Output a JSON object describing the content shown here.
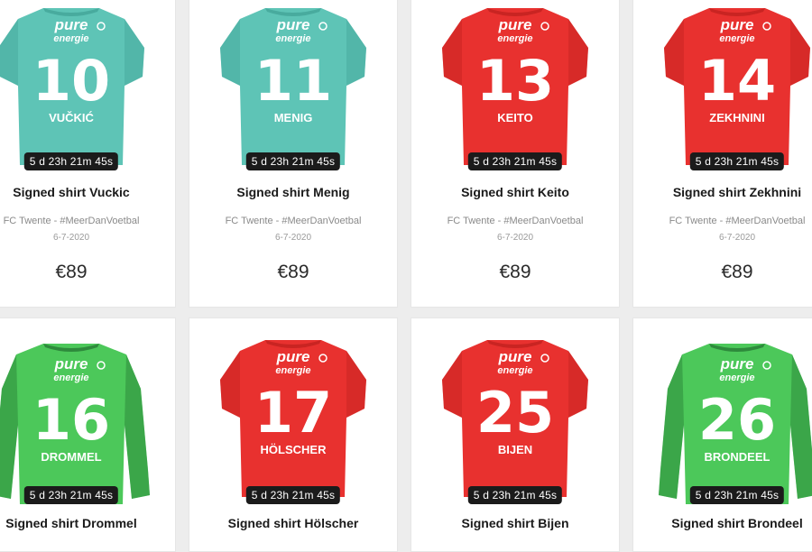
{
  "products": [
    {
      "title": "Signed shirt Vuckic",
      "subtitle": "FC Twente - #MeerDanVoetbal",
      "date": "6-7-2020",
      "price": "€89",
      "timer": "5 d 23h 21m 45s",
      "number": "10",
      "name": "VUČKIĆ",
      "sponsor_top": "pure",
      "sponsor_bottom": "energie",
      "shirt_color": "#5ec4b6",
      "shirt_shade": "#48ab9e",
      "sleeve": "short"
    },
    {
      "title": "Signed shirt Menig",
      "subtitle": "FC Twente - #MeerDanVoetbal",
      "date": "6-7-2020",
      "price": "€89",
      "timer": "5 d 23h 21m 45s",
      "number": "11",
      "name": "MENIG",
      "sponsor_top": "pure",
      "sponsor_bottom": "energie",
      "shirt_color": "#5ec4b6",
      "shirt_shade": "#48ab9e",
      "sleeve": "short"
    },
    {
      "title": "Signed shirt Keito",
      "subtitle": "FC Twente - #MeerDanVoetbal",
      "date": "6-7-2020",
      "price": "€89",
      "timer": "5 d 23h 21m 45s",
      "number": "13",
      "name": "KEITO",
      "sponsor_top": "pure",
      "sponsor_bottom": "energie",
      "shirt_color": "#e8312f",
      "shirt_shade": "#c92422",
      "sleeve": "short"
    },
    {
      "title": "Signed shirt Zekhnini",
      "subtitle": "FC Twente - #MeerDanVoetbal",
      "date": "6-7-2020",
      "price": "€89",
      "timer": "5 d 23h 21m 45s",
      "number": "14",
      "name": "ZEKHNINI",
      "sponsor_top": "pure",
      "sponsor_bottom": "energie",
      "shirt_color": "#e8312f",
      "shirt_shade": "#c92422",
      "sleeve": "short"
    },
    {
      "title": "Signed shirt Drommel",
      "timer": "5 d 23h 21m 45s",
      "number": "16",
      "name": "DROMMEL",
      "sponsor_top": "pure",
      "sponsor_bottom": "energie",
      "shirt_color": "#4cc85a",
      "shirt_shade": "#2e8a3c",
      "sleeve": "long"
    },
    {
      "title": "Signed shirt Hölscher",
      "timer": "5 d 23h 21m 45s",
      "number": "17",
      "name": "HÖLSCHER",
      "sponsor_top": "pure",
      "sponsor_bottom": "energie",
      "shirt_color": "#e8312f",
      "shirt_shade": "#c92422",
      "sleeve": "short"
    },
    {
      "title": "Signed shirt Bijen",
      "timer": "5 d 23h 21m 45s",
      "number": "25",
      "name": "BIJEN",
      "sponsor_top": "pure",
      "sponsor_bottom": "energie",
      "shirt_color": "#e8312f",
      "shirt_shade": "#c92422",
      "sleeve": "short"
    },
    {
      "title": "Signed shirt Brondeel",
      "timer": "5 d 23h 21m 45s",
      "number": "26",
      "name": "BRONDEEL",
      "sponsor_top": "pure",
      "sponsor_bottom": "energie",
      "shirt_color": "#4cc85a",
      "shirt_shade": "#2e8a3c",
      "sleeve": "long"
    }
  ]
}
